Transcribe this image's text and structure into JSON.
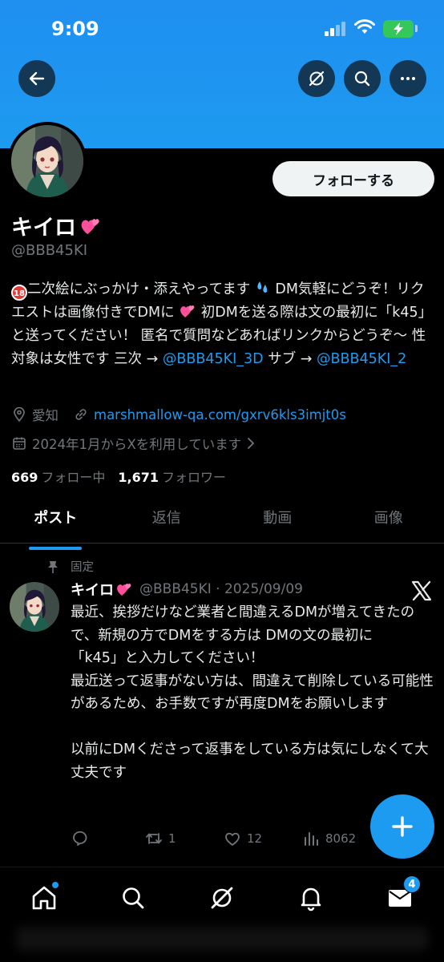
{
  "status_bar": {
    "time": "9:09"
  },
  "profile": {
    "display_name": "キイロ",
    "handle": "@BBB45KI",
    "follow_label": "フォローする",
    "bio": {
      "no18": "18",
      "line_a": "二次絵にぶっかけ・添えやってます",
      "line_b": " DM気軽にどうぞ！リクエストは画像付きでDMに",
      "line_c": " 初DMを送る際は文の最初に「k45」と送ってください！ 匿名で質問などあればリンクからどうぞ〜 性対象は女性です 三次 → ",
      "link_3d": "@BBB45KI_3D",
      "line_d": " サブ → ",
      "link_sub": "@BBB45KI_2"
    },
    "location": "愛知",
    "website": "marshmallow-qa.com/gxrv6kls3imjt0s",
    "joined": "2024年1月からXを利用しています",
    "following_count": "669",
    "following_label": "フォロー中",
    "followers_count": "1,671",
    "followers_label": "フォロワー"
  },
  "tabs": [
    {
      "label": "ポスト",
      "active": true
    },
    {
      "label": "返信"
    },
    {
      "label": "動画"
    },
    {
      "label": "画像"
    }
  ],
  "post": {
    "pinned_label": "固定",
    "author_name": "キイロ",
    "handle_date": "@BBB45KI · 2025/09/09",
    "text": "最近、挨拶だけなど業者と間違えるDMが増えてきたので、新規の方でDMをする方は DMの文の最初に\n「k45」と入力してください！\n最近送って返事がない方は、間違えて削除している可能性があるため、お手数ですが再度DMをお願いします\n\n以前にDMくださって返事をしている方は気にしなくて大丈夫です",
    "retweets": "1",
    "likes": "12",
    "views": "8062"
  },
  "bottom_nav": {
    "messages_badge": "4"
  },
  "colors": {
    "accent": "#1d9bf0",
    "banner": "#1d9bf0",
    "background": "#000000"
  }
}
